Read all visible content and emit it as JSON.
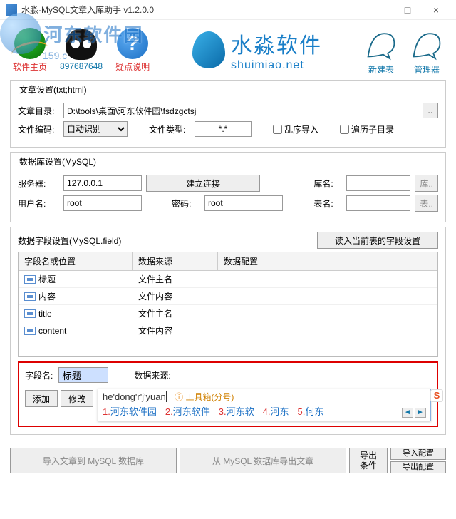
{
  "window": {
    "title": "水淼·MySQL文章入库助手 v1.2.0.0",
    "min": "—",
    "max": "□",
    "close": "×"
  },
  "watermark": {
    "text": "河东软件园",
    "url": "159.c"
  },
  "toolbar": {
    "home": "软件主页",
    "qq": "897687648",
    "help": "疑点说明",
    "brand_name": "水淼软件",
    "brand_url": "shuimiao.net",
    "newtable": "新建表",
    "manager": "管理器"
  },
  "article": {
    "title": "文章设置(txt;html)",
    "dir_label": "文章目录:",
    "dir_value": "D:\\tools\\桌面\\河东软件园\\fsdzgctsj",
    "dir_btn": "..",
    "enc_label": "文件编码:",
    "enc_value": "自动识别",
    "type_label": "文件类型:",
    "type_value": "*.*",
    "chk_random": "乱序导入",
    "chk_recurse": "遍历子目录"
  },
  "db": {
    "title": "数据库设置(MySQL)",
    "server_label": "服务器:",
    "server_value": "127.0.0.1",
    "connect": "建立连接",
    "user_label": "用户名:",
    "user_value": "root",
    "pass_label": "密码:",
    "pass_value": "root",
    "dbname_label": "库名:",
    "dbname_btn": "库..",
    "tbl_label": "表名:",
    "tbl_btn": "表.."
  },
  "fields": {
    "title": "数据字段设置(MySQL.field)",
    "read_btn": "读入当前表的字段设置",
    "cols": {
      "c1": "字段名或位置",
      "c2": "数据来源",
      "c3": "数据配置"
    },
    "rows": [
      {
        "name": "标题",
        "src": "文件主名"
      },
      {
        "name": "内容",
        "src": "文件内容"
      },
      {
        "name": "title",
        "src": "文件主名"
      },
      {
        "name": "content",
        "src": "文件内容"
      }
    ]
  },
  "edit": {
    "name_label": "字段名:",
    "name_value": "标题",
    "src_label": "数据来源:",
    "add": "添加",
    "modify": "修改"
  },
  "ime": {
    "input": "he'dong'r'j'yuan",
    "toolbox": "工具箱(分号)",
    "cands": [
      {
        "n": "1.",
        "t": "河东软件园"
      },
      {
        "n": "2.",
        "t": "河东软件"
      },
      {
        "n": "3.",
        "t": "河东软"
      },
      {
        "n": "4.",
        "t": "河东"
      },
      {
        "n": "5.",
        "t": "何东"
      }
    ],
    "prev": "◄",
    "next": "►",
    "logo": "S"
  },
  "bottom": {
    "import": "导入文章到 MySQL 数据库",
    "export": "从 MySQL 数据库导出文章",
    "cond": "导出\n条件",
    "impcfg": "导入配置",
    "expcfg": "导出配置"
  }
}
